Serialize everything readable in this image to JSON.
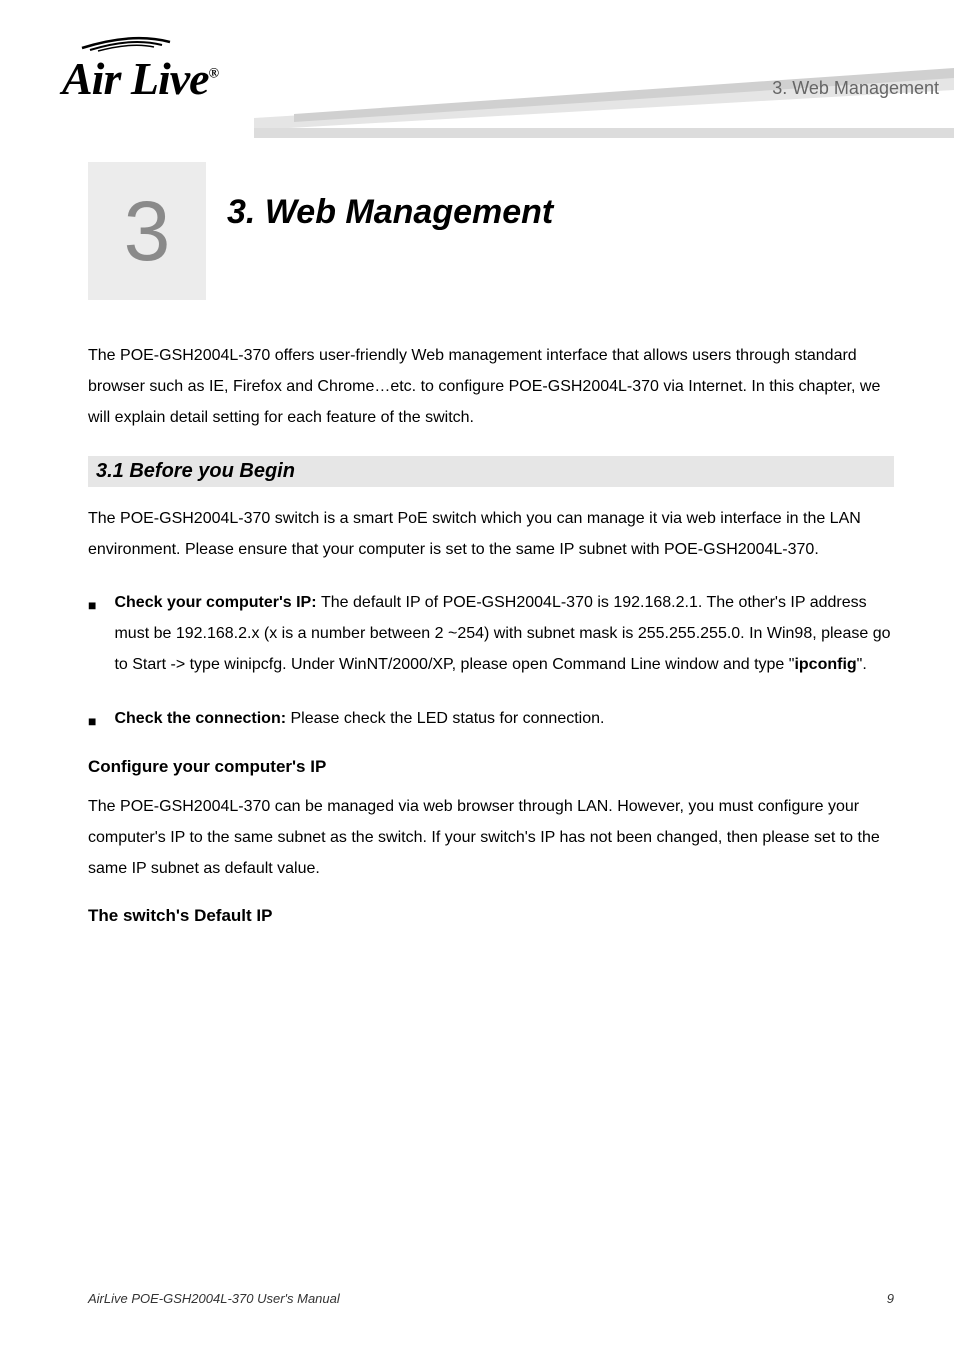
{
  "logo": {
    "text": "Air Live",
    "registered": "®"
  },
  "header_chapter_text": "3. Web Management",
  "chapter_number": "3",
  "chapter_title_line1": "Web Management",
  "intro_para": "The POE-GSH2004L-370 offers user-friendly Web management interface that allows users through standard browser such as IE, Firefox and Chrome…etc. to configure POE-GSH2004L-370 via Internet. In this chapter, we will explain detail setting for each feature of the switch.",
  "section_3_1_title": "3.1 Before you Begin",
  "section_3_1_para1": "The POE-GSH2004L-370 switch is a smart PoE switch which you can manage it via web interface in the LAN environment. Please ensure that your computer is set to the same IP subnet with POE-GSH2004L-370.",
  "bullet1_label": "Check your computer's IP: ",
  "bullet1_text": "The default IP of POE-GSH2004L-370 is 192.168.2.1. The other's IP address must be 192.168.2.x (x is a number between 2 ~254) with subnet mask is 255.255.255.0. In Win98, please go to Start -> type winipcfg. Under WinNT/2000/XP, please open Command Line window and type \"",
  "bullet1_ipconfig": "ipconfig",
  "bullet1_text_end": "\".",
  "bullet2_label": "Check the connection: ",
  "bullet2_text": "Please check the LED status for connection.",
  "configure_ip_title": "Configure your computer's IP",
  "configure_ip_para": "The POE-GSH2004L-370 can be managed via web browser through LAN. However, you must configure your computer's IP to the same subnet as the switch. If your switch's IP has not been changed, then please set to the same IP subnet as default value.",
  "switch_default_ip_title": "The switch's Default IP",
  "footer_left": "AirLive POE-GSH2004L-370 User's Manual",
  "footer_right": "9"
}
